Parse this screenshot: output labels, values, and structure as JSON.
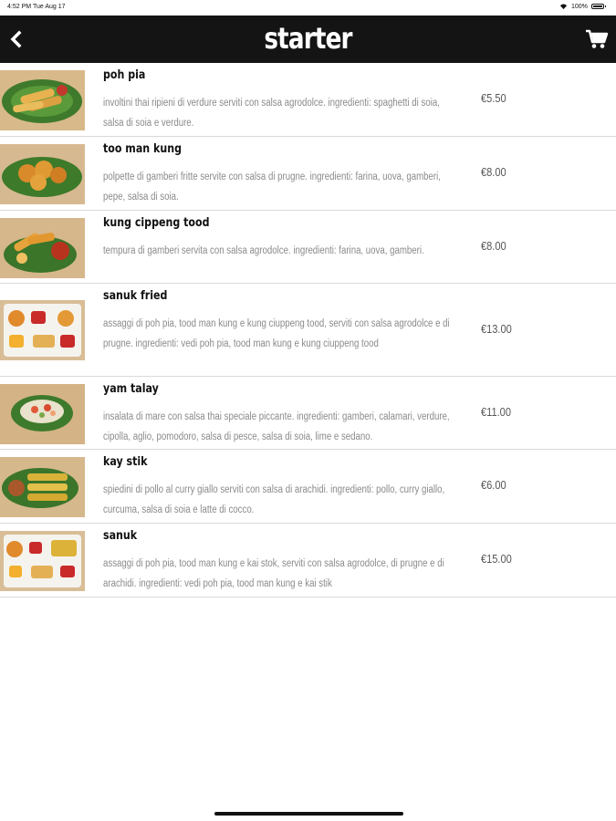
{
  "status_bar": {
    "time": "4:52 PM",
    "date": "Tue Aug 17",
    "battery": "100%"
  },
  "header": {
    "title": "starter",
    "back_icon": "chevron-left-icon",
    "cart_icon": "cart-icon"
  },
  "items": [
    {
      "name": "poh pia",
      "description": "involtini thai ripieni di verdure serviti con salsa agrodolce. ingredienti: spaghetti di soia, salsa di soia e verdure.",
      "price": "€5.50"
    },
    {
      "name": "too man kung",
      "description": "polpette di gamberi fritte servite con salsa di prugne. ingredienti: farina, uova, gamberi, pepe, salsa di soia.",
      "price": "€8.00"
    },
    {
      "name": "kung cippeng tood",
      "description": "tempura di gamberi servita con salsa agrodolce. ingredienti: farina, uova, gamberi.",
      "price": "€8.00"
    },
    {
      "name": "sanuk fried",
      "description": "assaggi di poh pia, tood man kung e kung ciuppeng tood, serviti con salsa agrodolce e di prugne. ingredienti: vedi poh pia, tood man kung e kung ciuppeng tood",
      "price": "€13.00"
    },
    {
      "name": "yam talay",
      "description": "insalata di mare con salsa thai speciale piccante. ingredienti: gamberi, calamari, verdure, cipolla, aglio, pomodoro, salsa di pesce, salsa di soia, lime e sedano.",
      "price": "€11.00"
    },
    {
      "name": "kay stik",
      "description": "spiedini di pollo al curry giallo serviti con salsa di arachidi. ingredienti: pollo, curry giallo, curcuma, salsa di soia e latte di cocco.",
      "price": "€6.00"
    },
    {
      "name": "sanuk",
      "description": "assaggi di poh pia, tood man kung e kai stok, serviti con salsa agrodolce, di prugne e di arachidi. ingredienti: vedi poh pia, tood man kung e kai stik",
      "price": "€15.00"
    }
  ]
}
